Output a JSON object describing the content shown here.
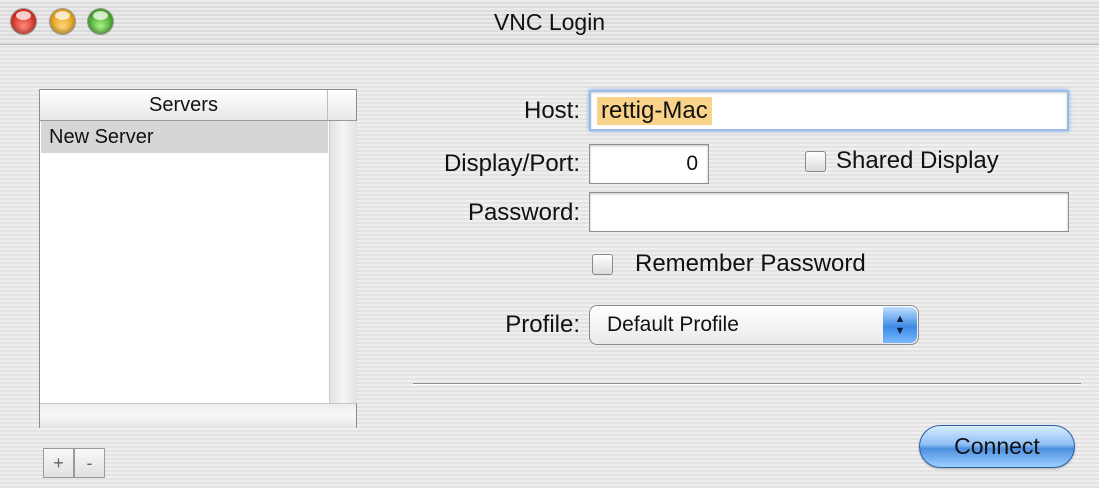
{
  "window": {
    "title": "VNC Login"
  },
  "servers": {
    "header": "Servers",
    "items": [
      "New Server"
    ],
    "add_label": "+",
    "remove_label": "-"
  },
  "form": {
    "host_label": "Host:",
    "host_value": "rettig-Mac",
    "port_label": "Display/Port:",
    "port_value": "0",
    "shared_display_label": "Shared Display",
    "shared_display_checked": false,
    "password_label": "Password:",
    "password_value": "",
    "remember_password_label": "Remember Password",
    "remember_password_checked": false,
    "profile_label": "Profile:",
    "profile_value": "Default Profile"
  },
  "actions": {
    "connect_label": "Connect"
  },
  "colors": {
    "selection_highlight": "#f9d38a",
    "focus_ring": "#7aa7e6",
    "aqua_button": "#4b8fe0"
  }
}
